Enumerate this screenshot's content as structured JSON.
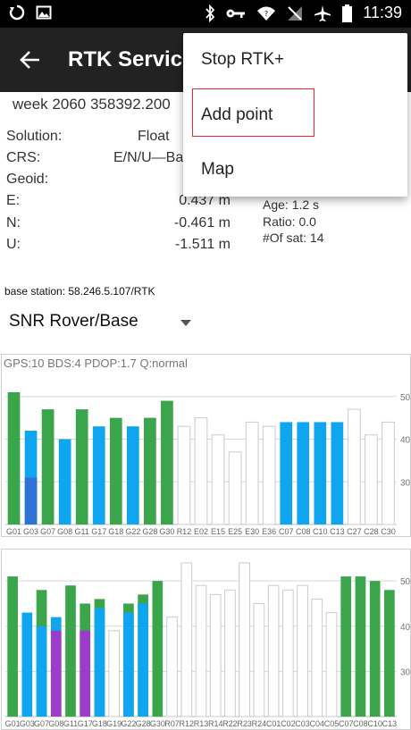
{
  "statusbar": {
    "time": "11:39",
    "icons_left": [
      "sync-icon",
      "image-icon"
    ],
    "icons_right": [
      "bluetooth-icon",
      "key-icon",
      "wifi-icon",
      "no-sim-icon",
      "airplane-icon",
      "battery-icon"
    ]
  },
  "appbar": {
    "title": "RTK Service"
  },
  "week_line": "week 2060 358392.200",
  "solution": {
    "solution_label": "Solution:",
    "solution_value": "Float",
    "crs_label": "CRS:",
    "crs_value": "E/N/U—Ba",
    "geoid_label": "Geoid:",
    "e_label": "E:",
    "e_value": "0.437 m",
    "n_label": "N:",
    "n_value": "-0.461 m",
    "u_label": "U:",
    "u_value": "-1.511 m",
    "age": "Age: 1.2 s",
    "ratio": "Ratio: 0.0",
    "sats": "#Of sat: 14"
  },
  "base_station": "base station: 58.246.5.107/RTK",
  "spinner": {
    "selected": "SNR Rover/Base"
  },
  "menu": {
    "items": [
      "Stop RTK+",
      "Add point",
      "Map"
    ],
    "highlighted": "Add point"
  },
  "colors": {
    "green": "#3aa54a",
    "blue": "#10a6ef",
    "dark_blue": "#2f72d6",
    "purple": "#9b3dcc",
    "outline": "#cccccc"
  },
  "chart_data": [
    {
      "type": "bar",
      "caption": "GPS:10 BDS:4 PDOP:1.7 Q:normal",
      "categories": [
        "G01",
        "G03",
        "G07",
        "G08",
        "G11",
        "G17",
        "G18",
        "G22",
        "G28",
        "G30",
        "R12",
        "E02",
        "E15",
        "E25",
        "E30",
        "E36",
        "C07",
        "C08",
        "C10",
        "C13",
        "C27",
        "C28",
        "C30"
      ],
      "ylim": [
        20,
        51
      ],
      "yticks": [
        30,
        40,
        50
      ],
      "bars": [
        {
          "name": "G01",
          "value": 51,
          "color": "green"
        },
        {
          "name": "G03",
          "value": 42,
          "color": "blue",
          "inner_value": 31,
          "inner_color": "dark_blue"
        },
        {
          "name": "G07",
          "value": 47,
          "color": "green"
        },
        {
          "name": "G08",
          "value": 40,
          "color": "blue"
        },
        {
          "name": "G11",
          "value": 47,
          "color": "green"
        },
        {
          "name": "G17",
          "value": 43,
          "color": "blue"
        },
        {
          "name": "G18",
          "value": 45,
          "color": "green"
        },
        {
          "name": "G22",
          "value": 43,
          "color": "blue"
        },
        {
          "name": "G28",
          "value": 45,
          "color": "green"
        },
        {
          "name": "G30",
          "value": 49,
          "color": "green"
        },
        {
          "name": "R12",
          "value": 43,
          "color": "outline"
        },
        {
          "name": "E02",
          "value": 45,
          "color": "outline"
        },
        {
          "name": "E15",
          "value": 41,
          "color": "outline"
        },
        {
          "name": "E25",
          "value": 37,
          "color": "outline"
        },
        {
          "name": "E30",
          "value": 44,
          "color": "outline"
        },
        {
          "name": "E36",
          "value": 43,
          "color": "outline"
        },
        {
          "name": "C07",
          "value": 44,
          "color": "blue"
        },
        {
          "name": "C08",
          "value": 44,
          "color": "blue"
        },
        {
          "name": "C10",
          "value": 44,
          "color": "blue"
        },
        {
          "name": "C13",
          "value": 44,
          "color": "blue"
        },
        {
          "name": "C27",
          "value": 47,
          "color": "outline"
        },
        {
          "name": "C28",
          "value": 41,
          "color": "outline"
        },
        {
          "name": "C30",
          "value": 44,
          "color": "outline"
        }
      ]
    },
    {
      "type": "bar",
      "categories": [
        "G01",
        "G03",
        "G07",
        "G08",
        "G11",
        "G17",
        "G18",
        "G19",
        "G22",
        "G28",
        "G30",
        "R07",
        "R12",
        "R13",
        "R14",
        "R22",
        "R23",
        "R24",
        "C01",
        "C02",
        "C03",
        "C04",
        "C05",
        "C07",
        "C08",
        "C10",
        "C13"
      ],
      "ylim": [
        20,
        53
      ],
      "yticks": [
        30,
        40,
        50
      ],
      "bars": [
        {
          "name": "G01",
          "value": 51,
          "color": "green"
        },
        {
          "name": "G03",
          "value": 43,
          "color": "blue"
        },
        {
          "name": "G07",
          "value": 48,
          "color": "green",
          "inner_value": 40,
          "inner_color": "blue"
        },
        {
          "name": "G08",
          "value": 42,
          "color": "blue",
          "inner_value": 39,
          "inner_color": "purple"
        },
        {
          "name": "G11",
          "value": 49,
          "color": "green"
        },
        {
          "name": "G17",
          "value": 45,
          "color": "green",
          "inner_value": 39,
          "inner_color": "purple"
        },
        {
          "name": "G18",
          "value": 46,
          "color": "green",
          "inner_value": 44,
          "inner_color": "blue"
        },
        {
          "name": "G19",
          "value": 39,
          "color": "outline"
        },
        {
          "name": "G22",
          "value": 45,
          "color": "green",
          "inner_value": 43,
          "inner_color": "blue"
        },
        {
          "name": "G28",
          "value": 47,
          "color": "green",
          "inner_value": 45,
          "inner_color": "blue"
        },
        {
          "name": "G30",
          "value": 50,
          "color": "green"
        },
        {
          "name": "R07",
          "value": 42,
          "color": "outline"
        },
        {
          "name": "R12",
          "value": 54,
          "color": "outline"
        },
        {
          "name": "R13",
          "value": 49,
          "color": "outline"
        },
        {
          "name": "R14",
          "value": 47,
          "color": "outline"
        },
        {
          "name": "R22",
          "value": 48,
          "color": "outline"
        },
        {
          "name": "R23",
          "value": 54,
          "color": "outline"
        },
        {
          "name": "R24",
          "value": 45,
          "color": "outline"
        },
        {
          "name": "C01",
          "value": 49,
          "color": "outline"
        },
        {
          "name": "C02",
          "value": 48,
          "color": "outline"
        },
        {
          "name": "C03",
          "value": 49,
          "color": "outline"
        },
        {
          "name": "C04",
          "value": 46,
          "color": "outline"
        },
        {
          "name": "C05",
          "value": 43,
          "color": "outline"
        },
        {
          "name": "C07",
          "value": 51,
          "color": "green"
        },
        {
          "name": "C08",
          "value": 51,
          "color": "green"
        },
        {
          "name": "C10",
          "value": 50,
          "color": "green"
        },
        {
          "name": "C13",
          "value": 48,
          "color": "green"
        }
      ]
    }
  ]
}
